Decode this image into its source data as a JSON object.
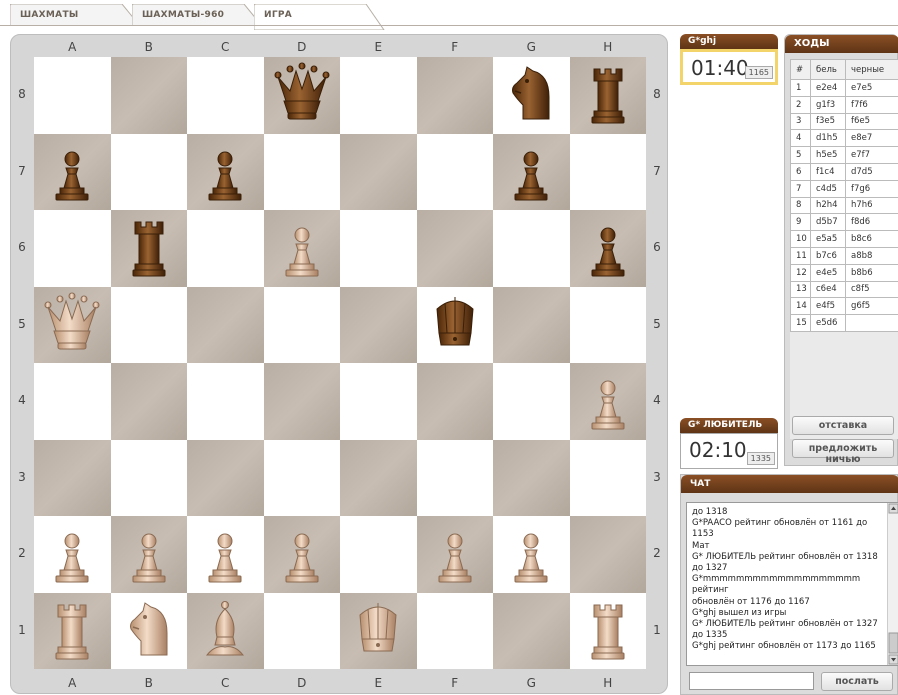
{
  "tabs": [
    {
      "label": "ШАХМАТЫ"
    },
    {
      "label": "ШАХМАТЫ-960"
    },
    {
      "label": "ИГРА"
    }
  ],
  "board": {
    "files": [
      "A",
      "B",
      "C",
      "D",
      "E",
      "F",
      "G",
      "H"
    ],
    "ranks": [
      "8",
      "7",
      "6",
      "5",
      "4",
      "3",
      "2",
      "1"
    ],
    "pieces": [
      {
        "square": "d8",
        "type": "queen",
        "color": "black"
      },
      {
        "square": "g8",
        "type": "knight",
        "color": "black"
      },
      {
        "square": "h8",
        "type": "rook",
        "color": "black"
      },
      {
        "square": "a7",
        "type": "pawn",
        "color": "black"
      },
      {
        "square": "c7",
        "type": "pawn",
        "color": "black"
      },
      {
        "square": "g7",
        "type": "pawn",
        "color": "black"
      },
      {
        "square": "b6",
        "type": "rook",
        "color": "black"
      },
      {
        "square": "d6",
        "type": "pawn",
        "color": "white"
      },
      {
        "square": "h6",
        "type": "pawn",
        "color": "black"
      },
      {
        "square": "a5",
        "type": "queen",
        "color": "white"
      },
      {
        "square": "f5",
        "type": "king",
        "color": "black"
      },
      {
        "square": "h4",
        "type": "pawn",
        "color": "white"
      },
      {
        "square": "a2",
        "type": "pawn",
        "color": "white"
      },
      {
        "square": "b2",
        "type": "pawn",
        "color": "white"
      },
      {
        "square": "c2",
        "type": "pawn",
        "color": "white"
      },
      {
        "square": "d2",
        "type": "pawn",
        "color": "white"
      },
      {
        "square": "f2",
        "type": "pawn",
        "color": "white"
      },
      {
        "square": "g2",
        "type": "pawn",
        "color": "white"
      },
      {
        "square": "a1",
        "type": "rook",
        "color": "white"
      },
      {
        "square": "b1",
        "type": "knight",
        "color": "white"
      },
      {
        "square": "c1",
        "type": "bishop",
        "color": "white"
      },
      {
        "square": "e1",
        "type": "king",
        "color": "white"
      },
      {
        "square": "h1",
        "type": "rook",
        "color": "white"
      }
    ]
  },
  "top_clock": {
    "name": "G*ghj",
    "time": "01:40",
    "rating": "1165"
  },
  "bottom_clock": {
    "name": "G* ЛЮБИТЕЛЬ",
    "time": "02:10",
    "rating": "1335"
  },
  "moves": {
    "title": "ХОДЫ",
    "headers": [
      "#",
      "бель",
      "черные"
    ],
    "rows": [
      [
        "1",
        "e2e4",
        "e7e5"
      ],
      [
        "2",
        "g1f3",
        "f7f6"
      ],
      [
        "3",
        "f3e5",
        "f6e5"
      ],
      [
        "4",
        "d1h5",
        "e8e7"
      ],
      [
        "5",
        "h5e5",
        "e7f7"
      ],
      [
        "6",
        "f1c4",
        "d7d5"
      ],
      [
        "7",
        "c4d5",
        "f7g6"
      ],
      [
        "8",
        "h2h4",
        "h7h6"
      ],
      [
        "9",
        "d5b7",
        "f8d6"
      ],
      [
        "10",
        "e5a5",
        "b8c6"
      ],
      [
        "11",
        "b7c6",
        "a8b8"
      ],
      [
        "12",
        "e4e5",
        "b8b6"
      ],
      [
        "13",
        "c6e4",
        "c8f5"
      ],
      [
        "14",
        "e4f5",
        "g6f5"
      ],
      [
        "15",
        "e5d6",
        ""
      ]
    ]
  },
  "buttons": {
    "resign": "отставка",
    "offer_draw": "предложить ничью",
    "send": "послать"
  },
  "chat": {
    "title": "ЧАТ",
    "lines": [
      "до 1318",
      "G*PAACO рейтинг обновлён от 1161 до",
      "1153",
      "Мат",
      "G* ЛЮБИТЕЛЬ рейтинг обновлён от 1318",
      "до 1327",
      "G*mmmmmmmmmmmmmmmmmmm рейтинг",
      "обновлён от 1176 до 1167",
      "G*ghj вышел из игры",
      "G* ЛЮБИТЕЛЬ рейтинг обновлён от 1327",
      "до 1335",
      "G*ghj рейтинг обновлён от 1173 до 1165"
    ],
    "input_value": ""
  },
  "colors": {
    "header_brown": "#6e3c1a",
    "dark_square": "#bdb2a7",
    "light_square": "#ffffff",
    "active_clock_border": "#f2d46a",
    "black_piece": "#6b3d15",
    "white_piece": "#d9b59a"
  }
}
